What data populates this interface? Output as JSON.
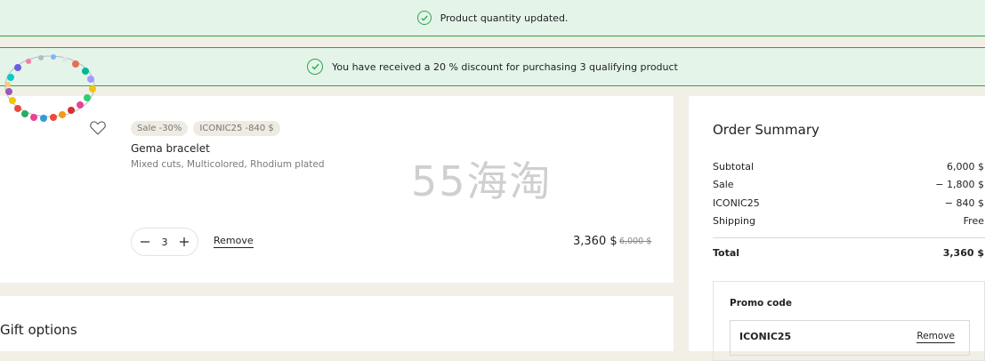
{
  "notifications": {
    "quantity_updated": "Product quantity updated.",
    "discount_message": "You have received a 20 % discount for purchasing 3 qualifying product"
  },
  "cart_item": {
    "badges": [
      "Sale -30%",
      "ICONIC25 -840 $"
    ],
    "name": "Gema bracelet",
    "description": "Mixed cuts, Multicolored, Rhodium plated",
    "quantity": "3",
    "remove_label": "Remove",
    "price_current": "3,360 $",
    "price_original": "6,000 $"
  },
  "watermark": "55海淘",
  "gift_options": {
    "title": "Gift options"
  },
  "order_summary": {
    "title": "Order Summary",
    "rows": [
      {
        "label": "Subtotal",
        "value": "6,000 $"
      },
      {
        "label": "Sale",
        "value": "− 1,800 $"
      },
      {
        "label": "ICONIC25",
        "value": "− 840 $"
      },
      {
        "label": "Shipping",
        "value": "Free"
      }
    ],
    "total_label": "Total",
    "total_value": "3,360 $",
    "promo": {
      "label": "Promo code",
      "code": "ICONIC25",
      "remove_label": "Remove"
    }
  },
  "colors": {
    "success_green": "#2da650",
    "notice_bg": "#e4f4e9",
    "page_bg": "#f1efe6"
  }
}
